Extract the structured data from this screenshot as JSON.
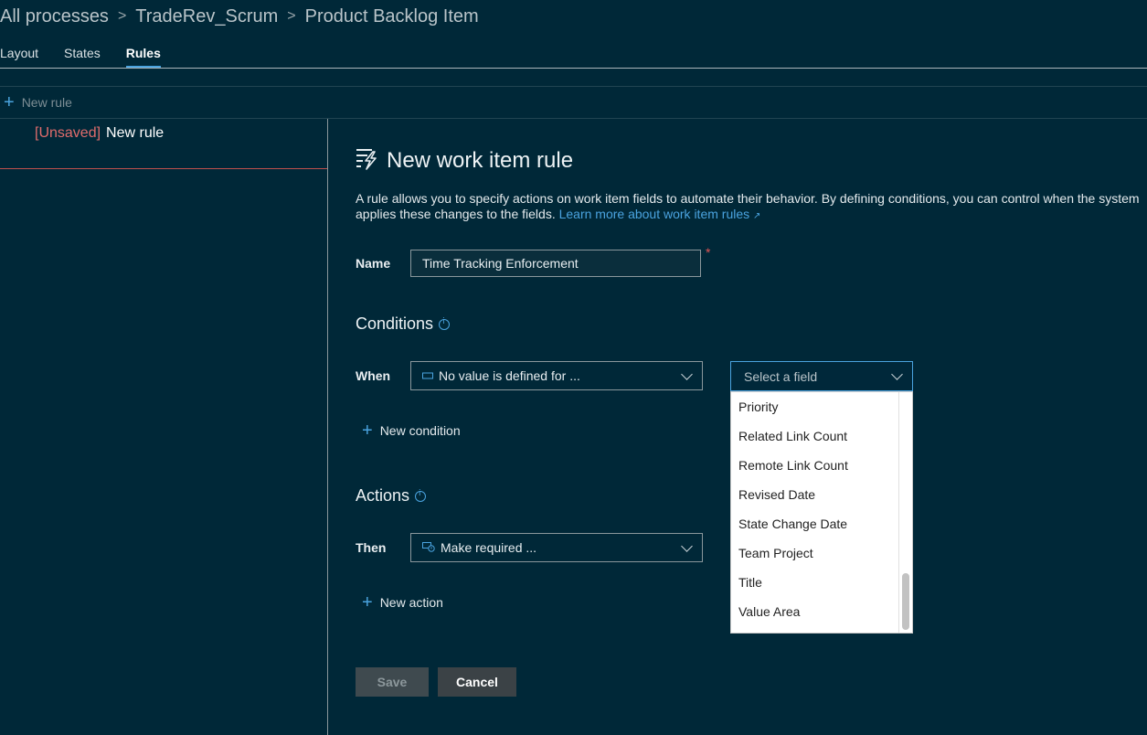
{
  "breadcrumb": {
    "items": [
      "All processes",
      "TradeRev_Scrum",
      "Product Backlog Item"
    ]
  },
  "tabs": [
    {
      "label": "Layout",
      "active": false
    },
    {
      "label": "States",
      "active": false
    },
    {
      "label": "Rules",
      "active": true
    }
  ],
  "toolbar": {
    "new_rule_label": "New rule"
  },
  "rules_list": [
    {
      "status": "[Unsaved]",
      "name": "New rule"
    }
  ],
  "editor": {
    "title": "New work item rule",
    "icon": "rule-icon",
    "description": "A rule allows you to specify actions on work item fields to automate their behavior. By defining conditions, you can control when the system applies these changes to the fields.",
    "learn_more": "Learn more about work item rules",
    "name_label": "Name",
    "name_value": "Time Tracking Enforcement",
    "required_marker": "*",
    "conditions_title": "Conditions",
    "when_label": "When",
    "when_value": "No value is defined for ...",
    "new_condition_label": "New condition",
    "actions_title": "Actions",
    "then_label": "Then",
    "then_value": "Make required ...",
    "new_action_label": "New action",
    "save_label": "Save",
    "cancel_label": "Cancel"
  },
  "field_select": {
    "placeholder": "Select a field",
    "options": [
      "Priority",
      "Related Link Count",
      "Remote Link Count",
      "Revised Date",
      "State Change Date",
      "Team Project",
      "Title",
      "Value Area"
    ]
  },
  "colors": {
    "background": "#002838",
    "accent": "#4aa3df",
    "unsaved": "#e06c6c"
  }
}
